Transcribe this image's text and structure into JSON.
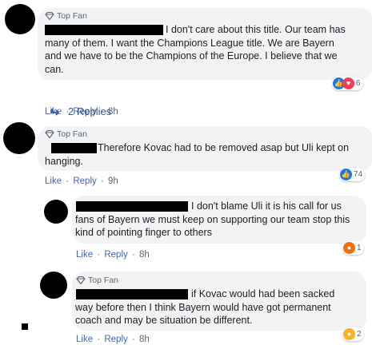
{
  "comments": [
    {
      "badge": "Top Fan",
      "text": "I don't care about this title. Our team has many of them. I want the Champions League title. We are Bayern and we have to be the Champions of the Europe. I believe that we can.",
      "line1": "I don't care about this title. Our team has",
      "line2": "many of them. I want the Champions League title. We are Bayern",
      "line3": "and we have to be the Champions of the Europe. I believe that we",
      "line4": "can.",
      "like": "Like",
      "reply": "Reply",
      "time": "8h",
      "reaction_count": "6",
      "reaction_icons": [
        "like",
        "love"
      ]
    },
    {
      "badge": "Top Fan",
      "line1": "Therefore Kovac had to be removed asap but Uli kept on",
      "line2": "hanging.",
      "like": "Like",
      "reply": "Reply",
      "time": "9h",
      "reaction_count": "74",
      "reaction_icons": [
        "like"
      ]
    }
  ],
  "replies_link": {
    "label": "2 Replies"
  },
  "replies": [
    {
      "line1": "I don't blame Uli it is his call for us",
      "line2": "fans of Bayern we must keep on supporting our team stop this",
      "line3": "kind of pointing finger to others",
      "like": "Like",
      "reply": "Reply",
      "time": "8h",
      "reaction_count": "1",
      "reaction_icons": [
        "angry"
      ]
    },
    {
      "badge": "Top Fan",
      "line1": "if Kovac would had been sacked",
      "line2": "way before then I think Bayern would have got permanent",
      "line3": "coach and may be situation be different.",
      "like": "Like",
      "reply": "Reply",
      "time": "8h",
      "reaction_count": "2",
      "reaction_icons": [
        "haha"
      ]
    }
  ],
  "separator": "·",
  "colors": {
    "link": "#4267b2",
    "bubble": "#f2f3f5",
    "like_blue": "#1877f2",
    "love_red": "#f33e58"
  },
  "icons": {
    "badge": "diamond-top-fan-icon",
    "replies_arrow": "reply-arrow-icon"
  }
}
